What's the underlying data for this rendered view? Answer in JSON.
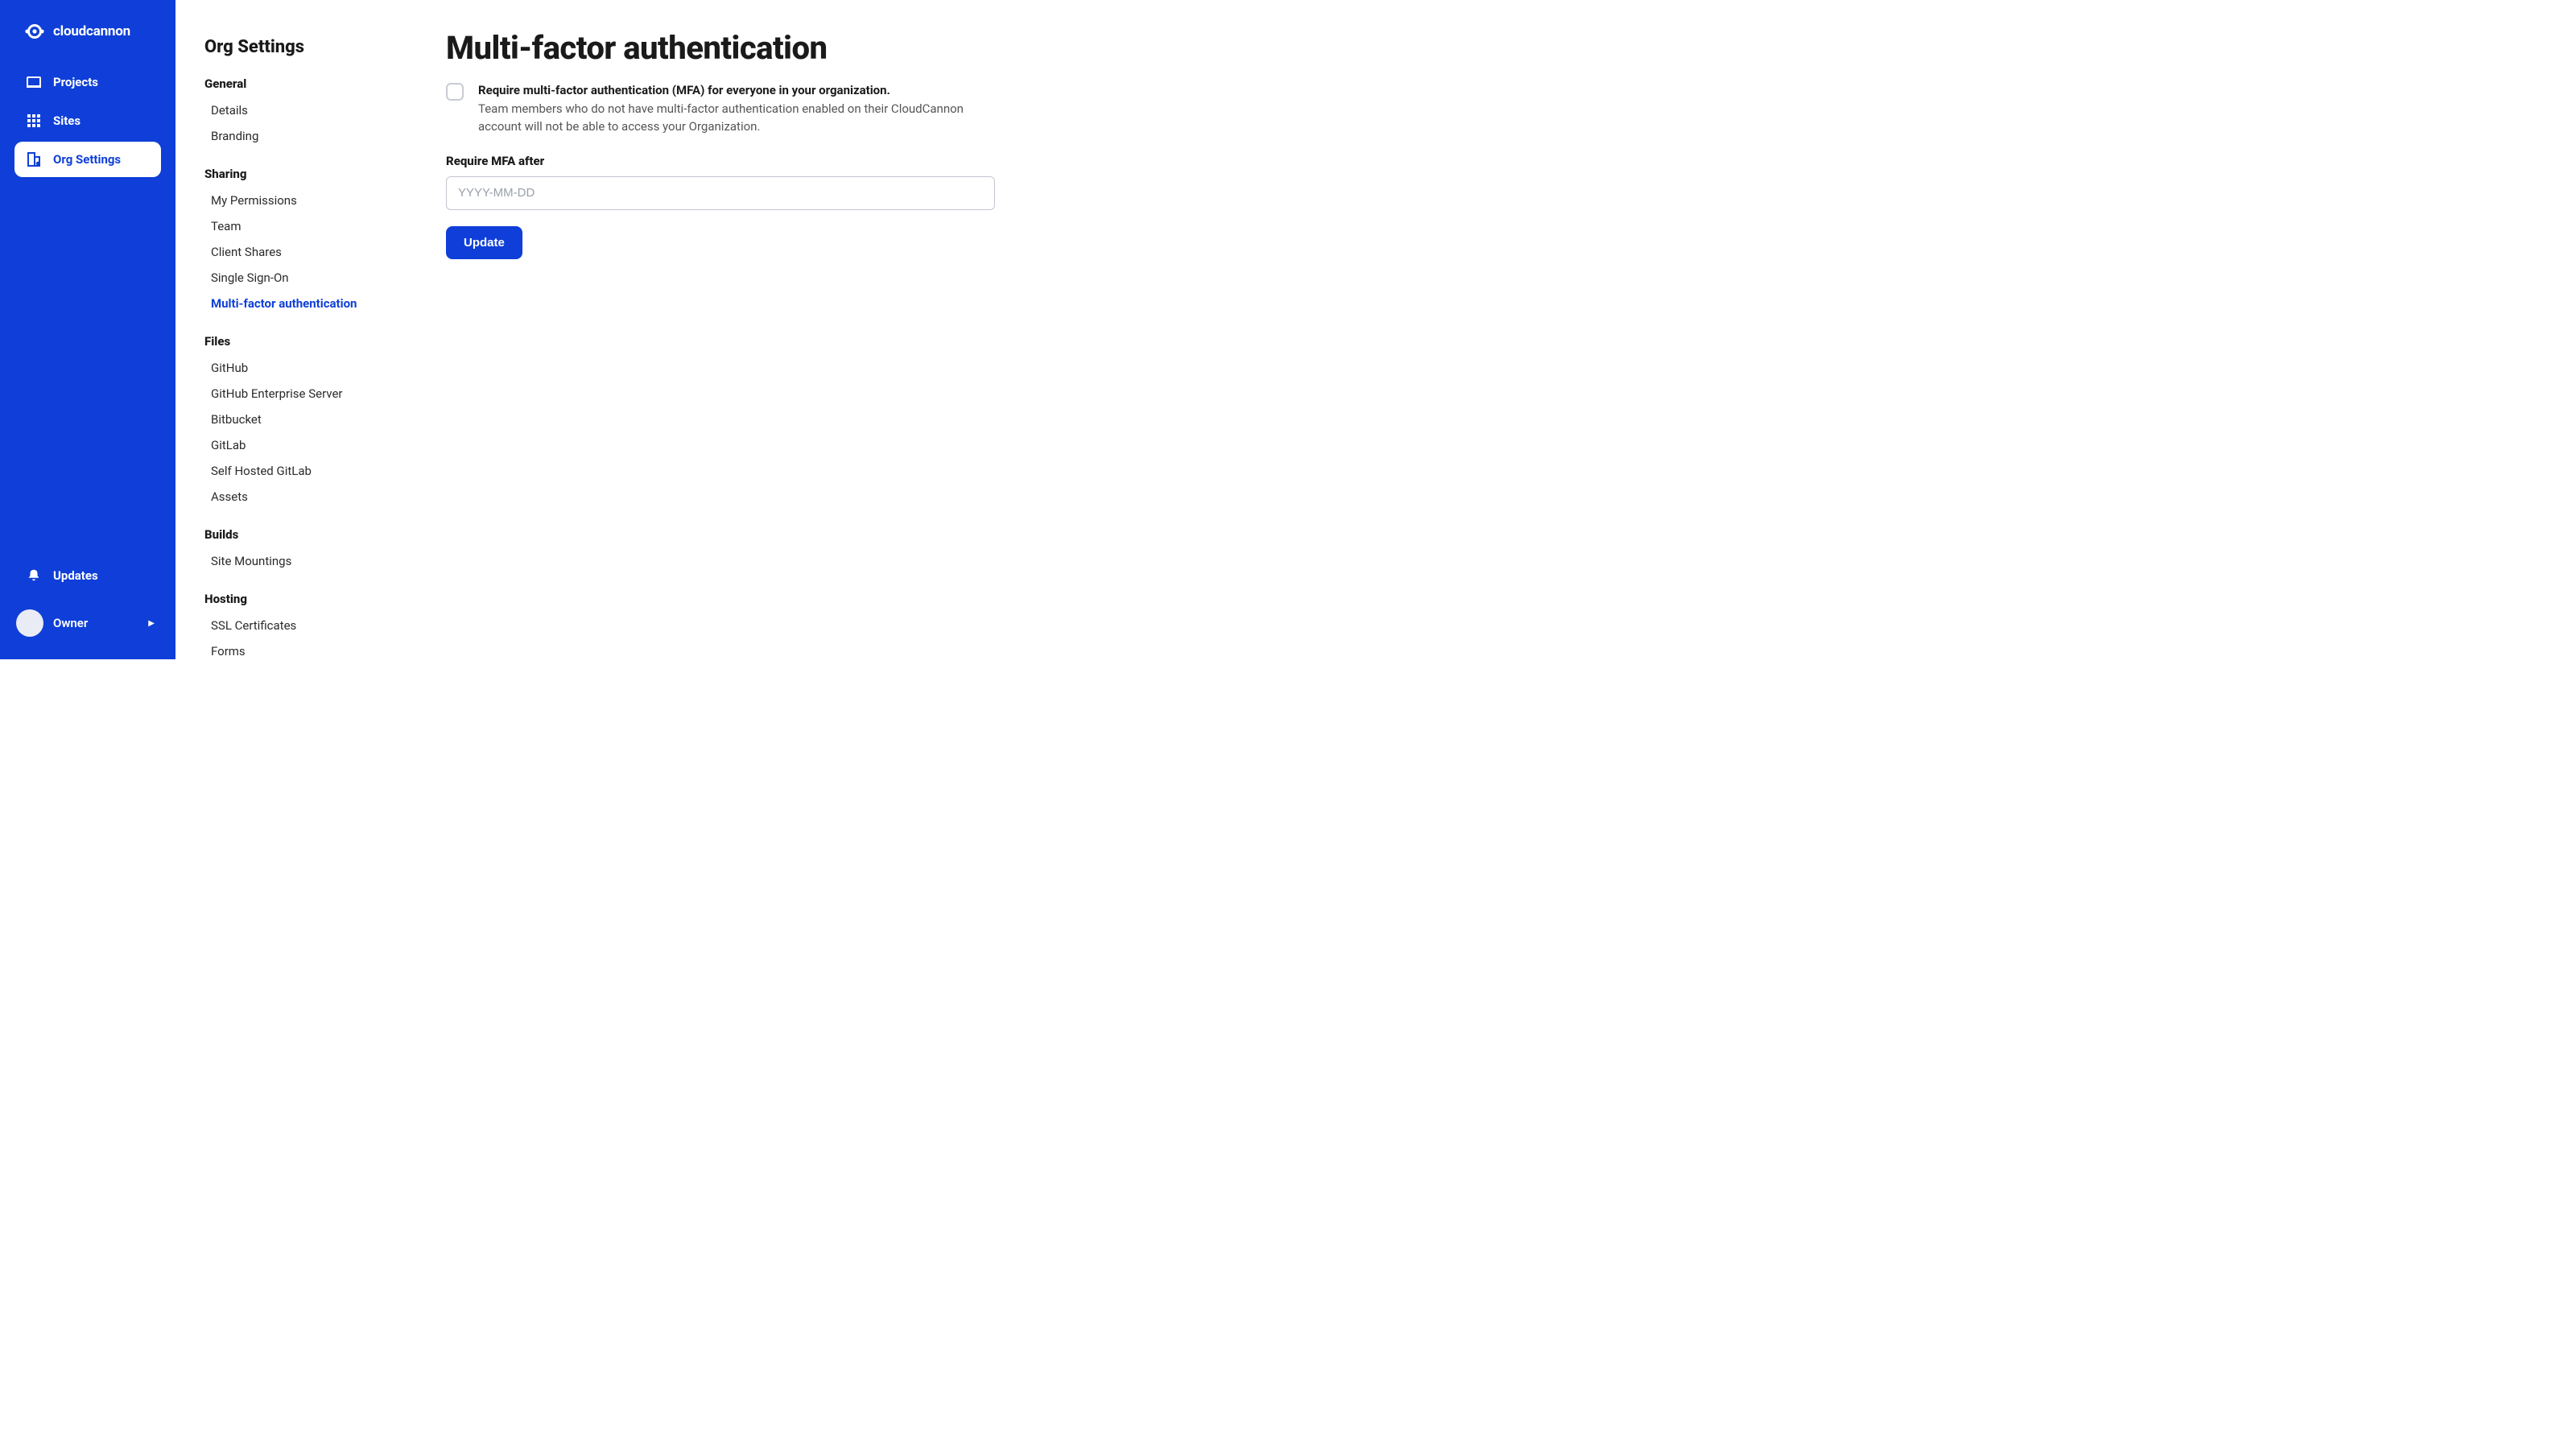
{
  "brand": {
    "name": "cloudcannon"
  },
  "primary_nav": {
    "items": [
      {
        "label": "Projects"
      },
      {
        "label": "Sites"
      },
      {
        "label": "Org Settings"
      }
    ],
    "updates_label": "Updates",
    "owner_label": "Owner"
  },
  "secondary_nav": {
    "title": "Org Settings",
    "groups": [
      {
        "header": "General",
        "links": [
          {
            "label": "Details"
          },
          {
            "label": "Branding"
          }
        ]
      },
      {
        "header": "Sharing",
        "links": [
          {
            "label": "My Permissions"
          },
          {
            "label": "Team"
          },
          {
            "label": "Client Shares"
          },
          {
            "label": "Single Sign-On"
          },
          {
            "label": "Multi-factor authentication",
            "active": true
          }
        ]
      },
      {
        "header": "Files",
        "links": [
          {
            "label": "GitHub"
          },
          {
            "label": "GitHub Enterprise Server"
          },
          {
            "label": "Bitbucket"
          },
          {
            "label": "GitLab"
          },
          {
            "label": "Self Hosted GitLab"
          },
          {
            "label": "Assets"
          }
        ]
      },
      {
        "header": "Builds",
        "links": [
          {
            "label": "Site Mountings"
          }
        ]
      },
      {
        "header": "Hosting",
        "links": [
          {
            "label": "SSL Certificates"
          },
          {
            "label": "Forms"
          }
        ]
      }
    ]
  },
  "main": {
    "title": "Multi-factor authentication",
    "checkbox_label": "Require multi-factor authentication (MFA) for everyone in your organization.",
    "checkbox_desc": "Team members who do not have multi-factor authentication enabled on their CloudCannon account will not be able to access your Organization.",
    "field_label": "Require MFA after",
    "field_placeholder": "YYYY-MM-DD",
    "field_value": "",
    "submit_label": "Update"
  }
}
